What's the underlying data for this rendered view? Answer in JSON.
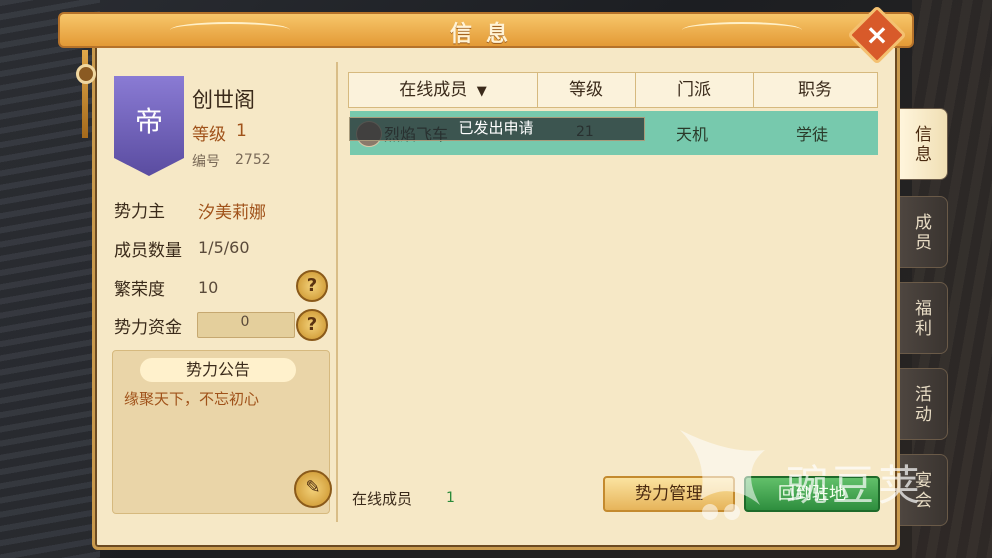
{
  "window": {
    "title": "信息",
    "close_icon": "close-icon"
  },
  "guild": {
    "emblem_char": "帝",
    "name": "创世阁",
    "level_label": "等级",
    "level_value": "1",
    "number_label": "编号",
    "number_value": "2752",
    "leader_label": "势力主",
    "leader_value": "汐美莉娜",
    "members_label": "成员数量",
    "members_value": "1/5/60",
    "prosperity_label": "繁荣度",
    "prosperity_value": "10",
    "funds_label": "势力资金",
    "funds_value": "0",
    "help_glyph": "?"
  },
  "notice": {
    "title": "势力公告",
    "text": "缘聚天下，不忘初心"
  },
  "table": {
    "headers": [
      "在线成员",
      "等级",
      "门派",
      "职务"
    ],
    "sort_icon": "▼",
    "rows": [
      {
        "name": "烈焰飞车",
        "level": "21",
        "school": "天机",
        "title": "学徒"
      }
    ]
  },
  "toast": "已发出申请",
  "footer": {
    "online_label": "在线成员",
    "online_value": "1",
    "manage_button": "势力管理",
    "return_button": "回到驻地"
  },
  "tabs": [
    "信息",
    "成员",
    "福利",
    "活动",
    "宴会"
  ],
  "watermark": "豌豆荚",
  "colors": {
    "accent": "#e39a36",
    "row_highlight": "#77c9ad",
    "panel": "#f6e8c6",
    "banner": "#6a5cb8"
  }
}
